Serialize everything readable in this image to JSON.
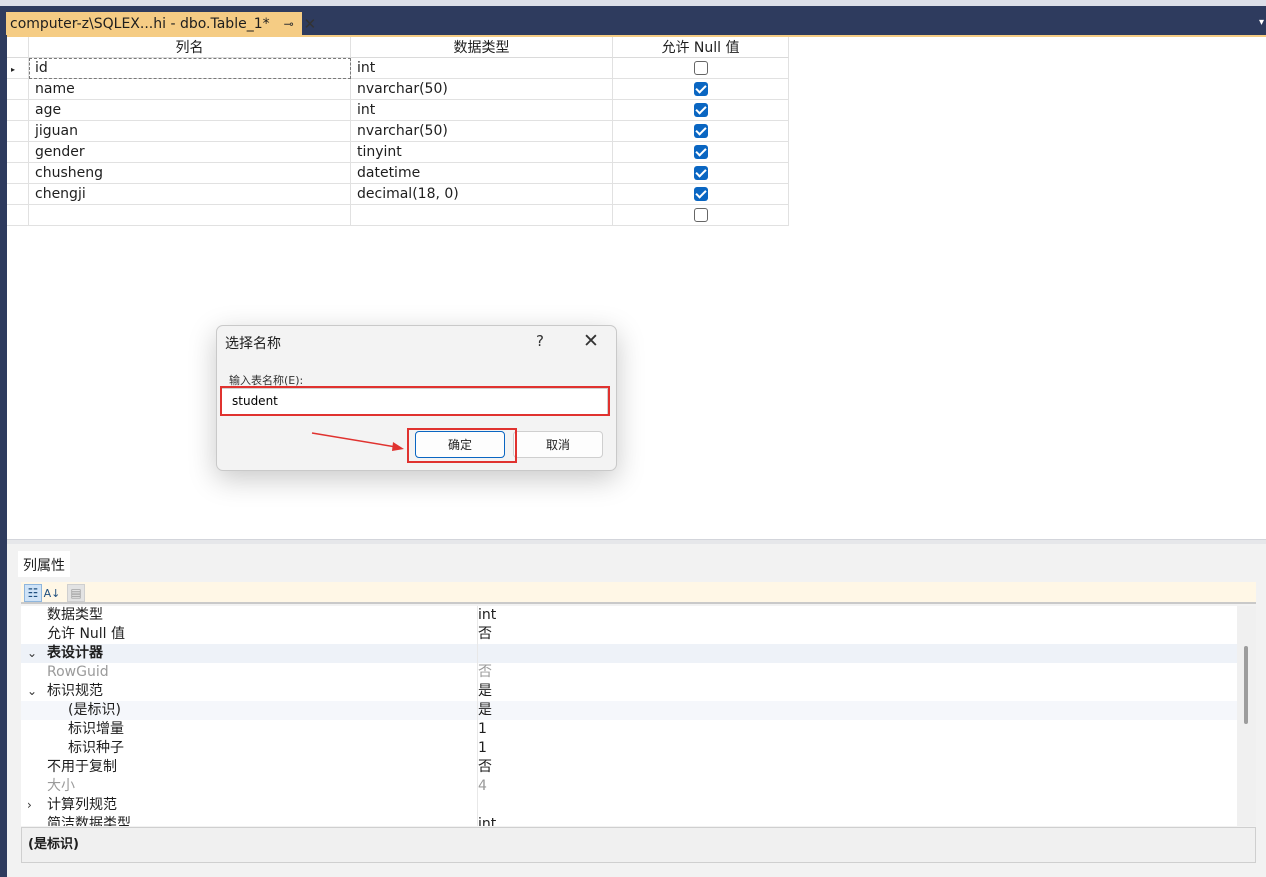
{
  "document_tab": {
    "title": "computer-z\\SQLEX...hi - dbo.Table_1*",
    "pin_icon": "pin-icon",
    "close_icon": "close-icon"
  },
  "grid": {
    "headers": {
      "column_name": "列名",
      "data_type": "数据类型",
      "allow_null": "允许 Null 值"
    },
    "rows": [
      {
        "name": "id",
        "type": "int",
        "allow_null": false,
        "selected": true
      },
      {
        "name": "name",
        "type": "nvarchar(50)",
        "allow_null": true
      },
      {
        "name": "age",
        "type": "int",
        "allow_null": true
      },
      {
        "name": "jiguan",
        "type": "nvarchar(50)",
        "allow_null": true
      },
      {
        "name": "gender",
        "type": "tinyint",
        "allow_null": true
      },
      {
        "name": "chusheng",
        "type": "datetime",
        "allow_null": true
      },
      {
        "name": "chengji",
        "type": "decimal(18, 0)",
        "allow_null": true
      },
      {
        "name": "",
        "type": "",
        "allow_null": false
      }
    ]
  },
  "dialog": {
    "title": "选择名称",
    "help": "?",
    "close": "✕",
    "label": "输入表名称(E):",
    "input_value": "student",
    "ok_label": "确定",
    "cancel_label": "取消",
    "highlight_color": "#e0322f"
  },
  "properties": {
    "tab_label": "列属性",
    "rows": [
      {
        "name": "数据类型",
        "value": "int"
      },
      {
        "name": "允许 Null 值",
        "value": "否"
      },
      {
        "name": "表设计器",
        "value": "",
        "category": true,
        "expanded": true
      },
      {
        "name": "RowGuid",
        "value": "否",
        "disabled": true
      },
      {
        "name": "标识规范",
        "value": "是",
        "expanded": true
      },
      {
        "name": "(是标识)",
        "value": "是"
      },
      {
        "name": "标识增量",
        "value": "1"
      },
      {
        "name": "标识种子",
        "value": "1"
      },
      {
        "name": "不用于复制",
        "value": "否"
      },
      {
        "name": "大小",
        "value": "4",
        "disabled": true
      },
      {
        "name": "计算列规范",
        "value": "",
        "collapsed": true
      },
      {
        "name": "简洁数据类型",
        "value": "int"
      }
    ],
    "description": "(是标识)"
  },
  "colors": {
    "tab_accent": "#f5cc84",
    "chrome": "#2e3b5e",
    "checkbox": "#0a66c2"
  }
}
